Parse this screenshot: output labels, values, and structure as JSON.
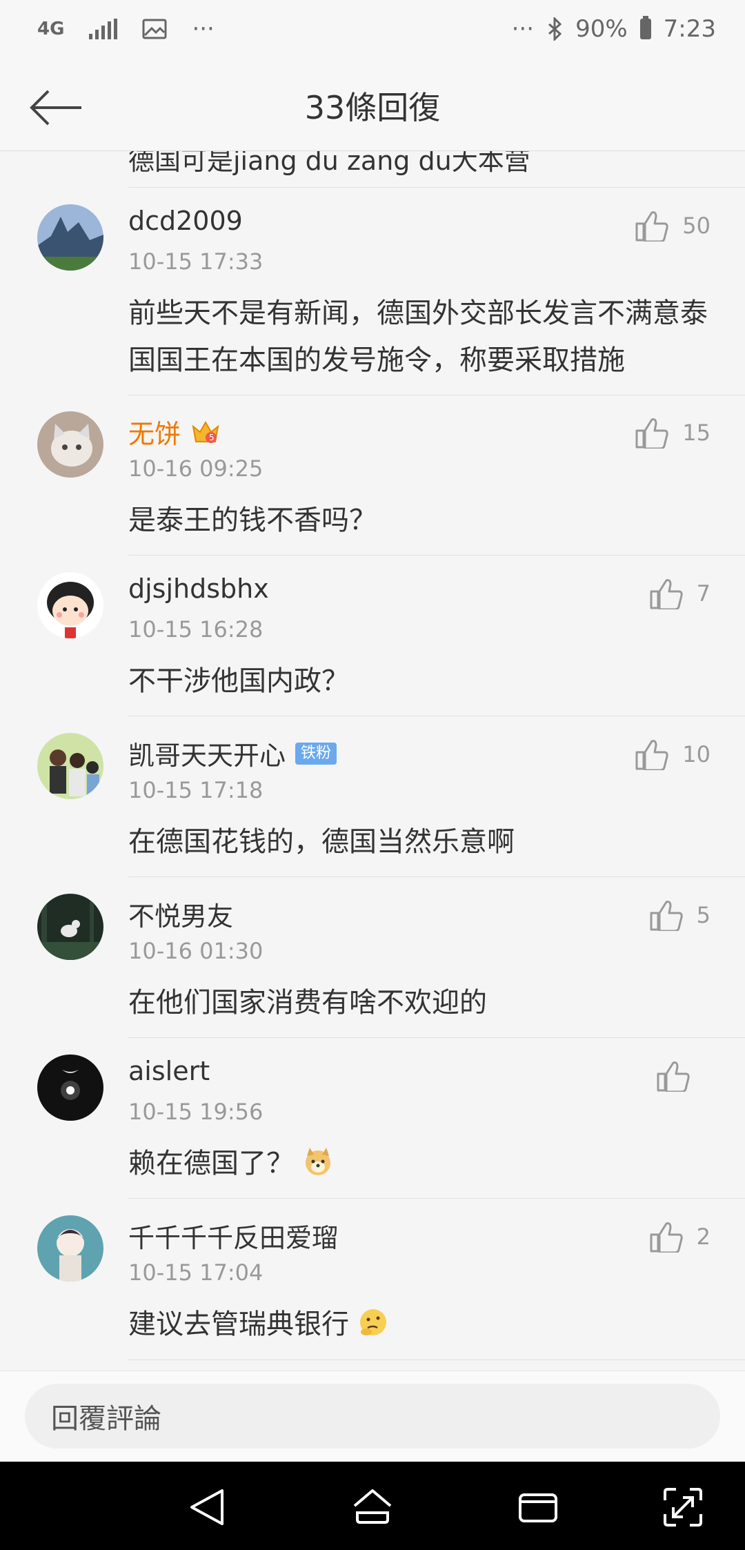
{
  "status_bar": {
    "network": "4G",
    "battery_percent": "90%",
    "time": "7:23",
    "more_left": "···",
    "more_right": "···"
  },
  "header": {
    "title": "33條回復"
  },
  "previous_comment_tail": "德国可是jiang du zang du大本营",
  "comments": [
    {
      "username": "dcd2009",
      "time": "10-15 17:33",
      "content": "前些天不是有新闻，德国外交部长发言不满意泰国国王在本国的发号施令，称要采取措施",
      "likes": "50",
      "avatar": "mountain-avatar"
    },
    {
      "username": "无饼",
      "vip_level": "5",
      "time": "10-16 09:25",
      "content": "是泰王的钱不香吗？",
      "likes": "15",
      "avatar": "cat-avatar"
    },
    {
      "username": "djsjhdsbhx",
      "time": "10-15 16:28",
      "content": "不干涉他国内政？",
      "likes": "7",
      "avatar": "cartoon-girl-avatar"
    },
    {
      "username": "凯哥天天开心",
      "badge": "铁粉",
      "time": "10-15 17:18",
      "content": "在德国花钱的，德国当然乐意啊",
      "likes": "10",
      "avatar": "group-photo-avatar"
    },
    {
      "username": "不悦男友",
      "time": "10-16 01:30",
      "content": "在他们国家消费有啥不欢迎的",
      "likes": "5",
      "avatar": "forest-animal-avatar"
    },
    {
      "username": "aislert",
      "time": "10-15 19:56",
      "content": "赖在德国了？",
      "likes": "",
      "avatar": "moon-avatar",
      "emoji": "doge-emoji"
    },
    {
      "username": "千千千千反田爱瑠",
      "time": "10-15 17:04",
      "content": "建议去管瑞典银行",
      "likes": "2",
      "avatar": "anime-girl-avatar",
      "emoji": "thinking-emoji"
    }
  ],
  "reply_bar": {
    "placeholder": "回覆評論"
  },
  "colors": {
    "vip_name": "#f07800",
    "badge_bg": "#6aa9ee",
    "secondary_text": "#999999"
  }
}
